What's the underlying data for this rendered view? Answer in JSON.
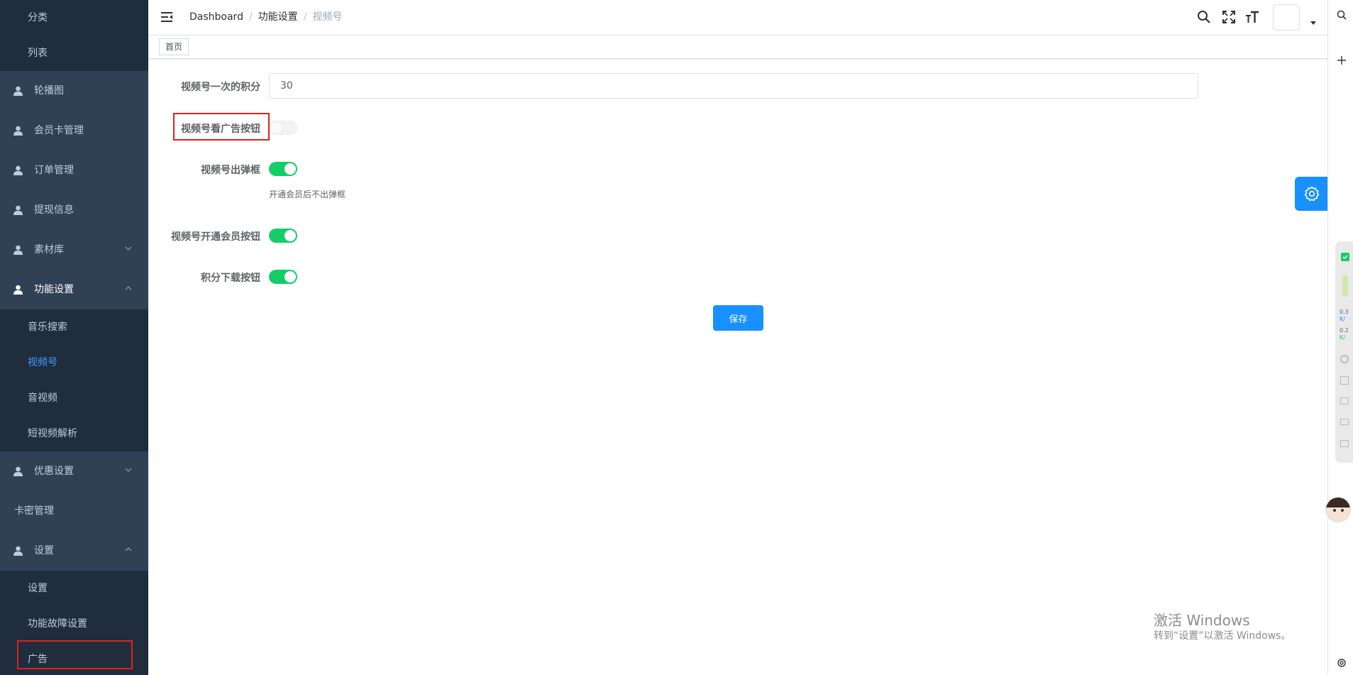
{
  "sidebar": {
    "top_items": [
      "分类",
      "列表"
    ],
    "menus": [
      {
        "label": "轮播图",
        "type": "user"
      },
      {
        "label": "会员卡管理",
        "type": "user"
      },
      {
        "label": "订单管理",
        "type": "user"
      },
      {
        "label": "提现信息",
        "type": "user"
      },
      {
        "label": "素材库",
        "type": "user",
        "arrow": "down"
      },
      {
        "label": "功能设置",
        "type": "user",
        "arrow": "up"
      }
    ],
    "func_sub": [
      "音乐搜索",
      "视频号",
      "音视频",
      "短视频解析"
    ],
    "func_active": "视频号",
    "menus2": [
      {
        "label": "优惠设置",
        "arrow": "down"
      },
      {
        "label": "卡密管理"
      },
      {
        "label": "设置",
        "arrow": "up"
      }
    ],
    "settings_sub": [
      "设置",
      "功能故障设置",
      "广告"
    ]
  },
  "header": {
    "breadcrumb": [
      "Dashboard",
      "功能设置",
      "视频号"
    ]
  },
  "tags": {
    "home": "首页"
  },
  "form": {
    "points_label": "视频号一次的积分",
    "points_value": "30",
    "ad_label": "视频号看广告按钮",
    "ad_on": false,
    "popup_label": "视频号出弹框",
    "popup_on": true,
    "popup_hint": "开通会员后不出弹框",
    "vip_label": "视频号开通会员按钮",
    "vip_on": true,
    "download_label": "积分下载按钮",
    "download_on": true,
    "save_label": "保存"
  },
  "widget": {
    "upload_speed": "0.3",
    "download_speed": "0.2",
    "speed_unit": "K/"
  },
  "watermark": {
    "line1": "激活 Windows",
    "line2": "转到“设置”以激活 Windows。"
  },
  "colors": {
    "sidebar_bg": "#304156",
    "submenu_bg": "#1f2d3d",
    "active_text": "#409EFF",
    "switch_on": "#13ce66",
    "primary": "#1890ff",
    "highlight": "#e02020"
  },
  "icons": {
    "menu_user": "user-icon",
    "hamburger": "hamburger-icon",
    "search": "search-icon",
    "fullscreen": "fullscreen-icon",
    "font_size": "font-size-icon",
    "settings": "gear-icon"
  }
}
